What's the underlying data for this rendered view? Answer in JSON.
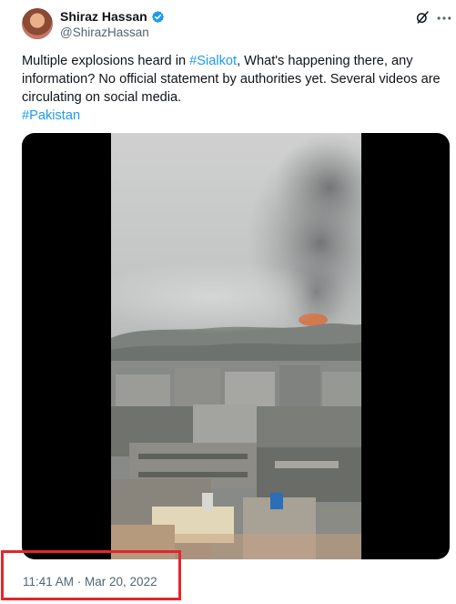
{
  "author": {
    "name": "Shiraz Hassan",
    "handle": "@ShirazHassan",
    "verified": true
  },
  "tweet": {
    "text_part1": "Multiple explosions heard in ",
    "hashtag_location": "#Sialkot",
    "text_part2": ", What's happening there, any information? No official statement by authorities yet. Several videos are circulating on social media.",
    "hashtag_country": "#Pakistan",
    "timestamp": "11:41 AM · Mar 20, 2022"
  },
  "icons": {
    "verified": "verified-badge-icon",
    "grok": "grok-icon",
    "more": "more-options-icon"
  },
  "colors": {
    "link": "#1d9bf0",
    "secondary_text": "#536471",
    "highlight_box": "#e3262b",
    "verified": "#1d9bf0"
  }
}
